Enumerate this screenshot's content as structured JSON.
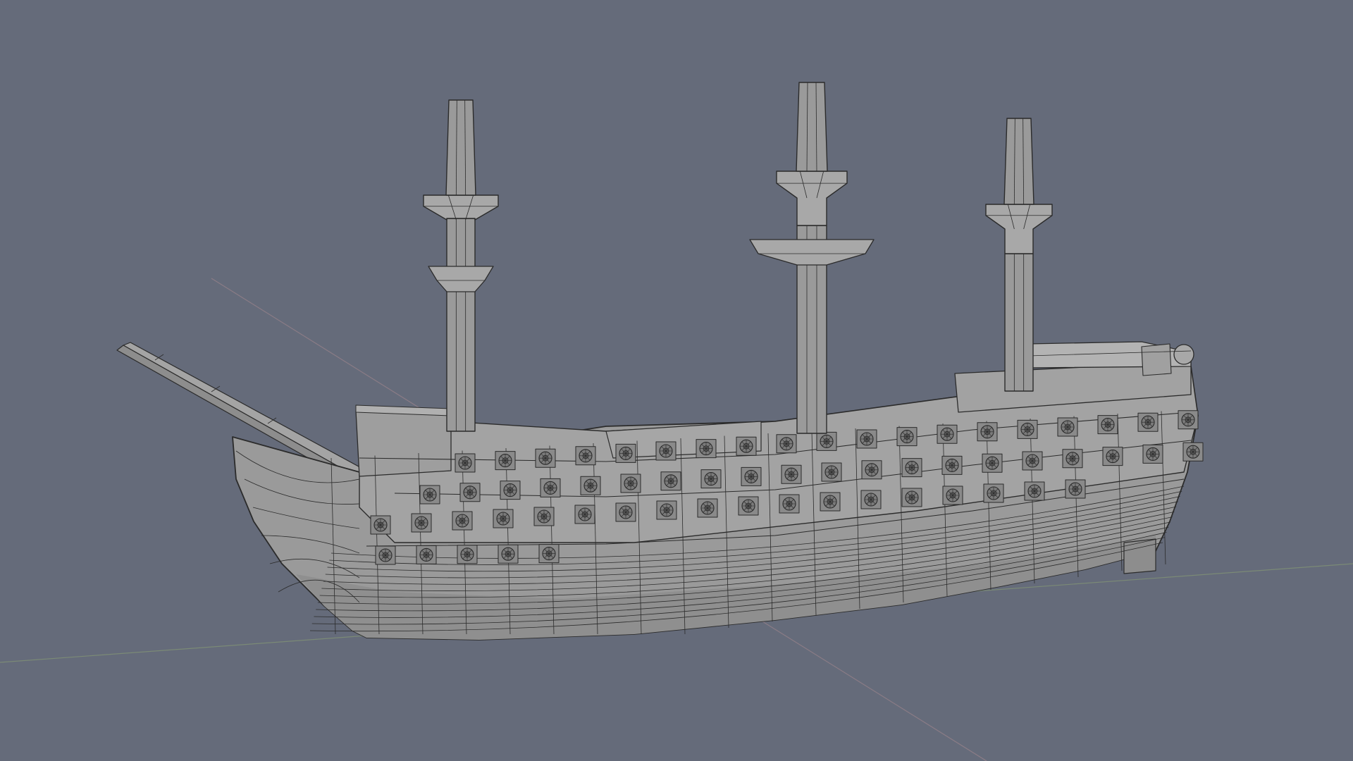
{
  "viewport": {
    "background": "#656b7a",
    "grid_axis_x_color": "#8a7c86",
    "grid_axis_y_color": "#7b8a76"
  },
  "model": {
    "fill": "#9a9a9a",
    "fill_light": "#a8a8a8",
    "fill_dark": "#8a8a8a",
    "wire": "#2b2b2b",
    "masts": 3,
    "gun_ports_visible": 62
  }
}
